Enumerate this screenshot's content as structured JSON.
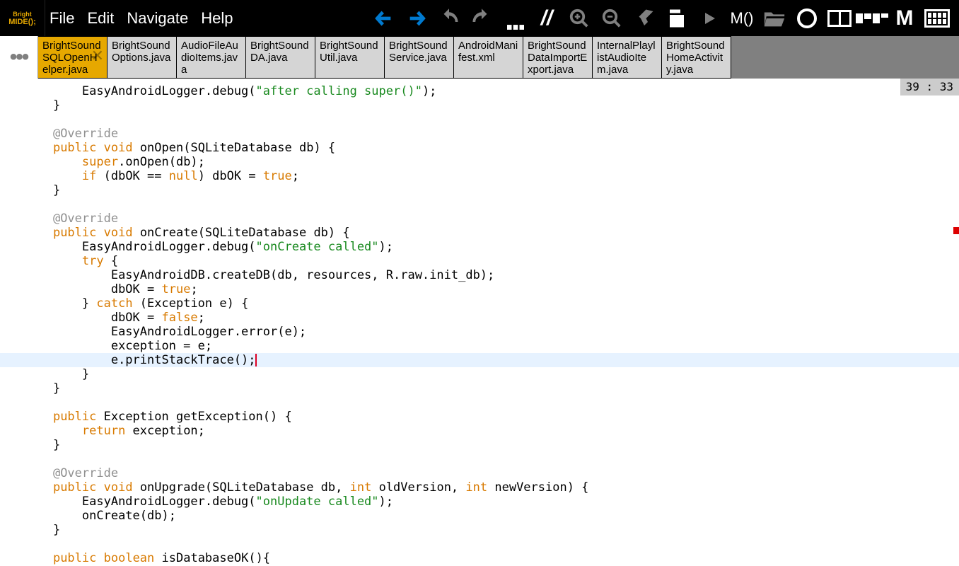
{
  "menu": {
    "file": "File",
    "edit": "Edit",
    "navigate": "Navigate",
    "help": "Help"
  },
  "logo": {
    "l1": "Bright",
    "l2": "MIDE();"
  },
  "tabs": [
    "BrightSoundSQLOpenHelper.java",
    "BrightSoundOptions.java",
    "AudioFileAudioItems.java",
    "BrightSoundDA.java",
    "BrightSoundUtil.java",
    "BrightSoundService.java",
    "AndroidManifest.xml",
    "BrightSoundDataImportExport.java",
    "InternalPlaylistAudioItem.java",
    "BrightSoundHomeActivity.java"
  ],
  "status": "39 : 33",
  "code": {
    "lines": [
      {
        "i": 8,
        "parts": [
          {
            "t": "EasyAndroidLogger.debug("
          },
          {
            "t": "\"after calling super()\"",
            "c": "str"
          },
          {
            "t": ");"
          }
        ]
      },
      {
        "i": 4,
        "parts": [
          {
            "t": "}"
          }
        ]
      },
      {
        "i": 0,
        "parts": [
          {
            "t": ""
          }
        ]
      },
      {
        "i": 4,
        "parts": [
          {
            "t": "@Override",
            "c": "ann"
          }
        ]
      },
      {
        "i": 4,
        "parts": [
          {
            "t": "public",
            "c": "kw"
          },
          {
            "t": " "
          },
          {
            "t": "void",
            "c": "kw"
          },
          {
            "t": " onOpen(SQLiteDatabase db) {"
          }
        ]
      },
      {
        "i": 8,
        "parts": [
          {
            "t": "super",
            "c": "kw"
          },
          {
            "t": ".onOpen(db);"
          }
        ]
      },
      {
        "i": 8,
        "parts": [
          {
            "t": "if",
            "c": "kw"
          },
          {
            "t": " (dbOK == "
          },
          {
            "t": "null",
            "c": "kw"
          },
          {
            "t": ") dbOK = "
          },
          {
            "t": "true",
            "c": "kw"
          },
          {
            "t": ";"
          }
        ]
      },
      {
        "i": 4,
        "parts": [
          {
            "t": "}"
          }
        ]
      },
      {
        "i": 0,
        "parts": [
          {
            "t": ""
          }
        ]
      },
      {
        "i": 4,
        "parts": [
          {
            "t": "@Override",
            "c": "ann"
          }
        ]
      },
      {
        "i": 4,
        "parts": [
          {
            "t": "public",
            "c": "kw"
          },
          {
            "t": " "
          },
          {
            "t": "void",
            "c": "kw"
          },
          {
            "t": " onCreate(SQLiteDatabase db) {"
          }
        ]
      },
      {
        "i": 8,
        "parts": [
          {
            "t": "EasyAndroidLogger.debug("
          },
          {
            "t": "\"onCreate called\"",
            "c": "str"
          },
          {
            "t": ");"
          }
        ]
      },
      {
        "i": 8,
        "parts": [
          {
            "t": "try",
            "c": "kw"
          },
          {
            "t": " {"
          }
        ]
      },
      {
        "i": 12,
        "parts": [
          {
            "t": "EasyAndroidDB.createDB(db, resources, R.raw.init_db);"
          }
        ]
      },
      {
        "i": 12,
        "parts": [
          {
            "t": "dbOK = "
          },
          {
            "t": "true",
            "c": "kw"
          },
          {
            "t": ";"
          }
        ]
      },
      {
        "i": 8,
        "parts": [
          {
            "t": "} "
          },
          {
            "t": "catch",
            "c": "kw"
          },
          {
            "t": " (Exception e) {"
          }
        ]
      },
      {
        "i": 12,
        "parts": [
          {
            "t": "dbOK = "
          },
          {
            "t": "false",
            "c": "kw"
          },
          {
            "t": ";"
          }
        ]
      },
      {
        "i": 12,
        "parts": [
          {
            "t": "EasyAndroidLogger.error(e);"
          }
        ]
      },
      {
        "i": 12,
        "parts": [
          {
            "t": "exception = e;"
          }
        ]
      },
      {
        "i": 12,
        "hl": true,
        "cursor": true,
        "parts": [
          {
            "t": "e.printStackTrace();"
          }
        ]
      },
      {
        "i": 8,
        "parts": [
          {
            "t": "}"
          }
        ]
      },
      {
        "i": 4,
        "parts": [
          {
            "t": "}"
          }
        ]
      },
      {
        "i": 0,
        "parts": [
          {
            "t": ""
          }
        ]
      },
      {
        "i": 4,
        "parts": [
          {
            "t": "public",
            "c": "kw"
          },
          {
            "t": " Exception getException() {"
          }
        ]
      },
      {
        "i": 8,
        "parts": [
          {
            "t": "return",
            "c": "kw"
          },
          {
            "t": " exception;"
          }
        ]
      },
      {
        "i": 4,
        "parts": [
          {
            "t": "}"
          }
        ]
      },
      {
        "i": 0,
        "parts": [
          {
            "t": ""
          }
        ]
      },
      {
        "i": 4,
        "parts": [
          {
            "t": "@Override",
            "c": "ann"
          }
        ]
      },
      {
        "i": 4,
        "parts": [
          {
            "t": "public",
            "c": "kw"
          },
          {
            "t": " "
          },
          {
            "t": "void",
            "c": "kw"
          },
          {
            "t": " onUpgrade(SQLiteDatabase db, "
          },
          {
            "t": "int",
            "c": "kw"
          },
          {
            "t": " oldVersion, "
          },
          {
            "t": "int",
            "c": "kw"
          },
          {
            "t": " newVersion) {"
          }
        ]
      },
      {
        "i": 8,
        "parts": [
          {
            "t": "EasyAndroidLogger.debug("
          },
          {
            "t": "\"onUpdate called\"",
            "c": "str"
          },
          {
            "t": ");"
          }
        ]
      },
      {
        "i": 8,
        "parts": [
          {
            "t": "onCreate(db);"
          }
        ]
      },
      {
        "i": 4,
        "parts": [
          {
            "t": "}"
          }
        ]
      },
      {
        "i": 0,
        "parts": [
          {
            "t": ""
          }
        ]
      },
      {
        "i": 4,
        "parts": [
          {
            "t": "public",
            "c": "kw"
          },
          {
            "t": " "
          },
          {
            "t": "boolean",
            "c": "kw"
          },
          {
            "t": " isDatabaseOK(){"
          }
        ]
      }
    ]
  },
  "method_label": "M()"
}
